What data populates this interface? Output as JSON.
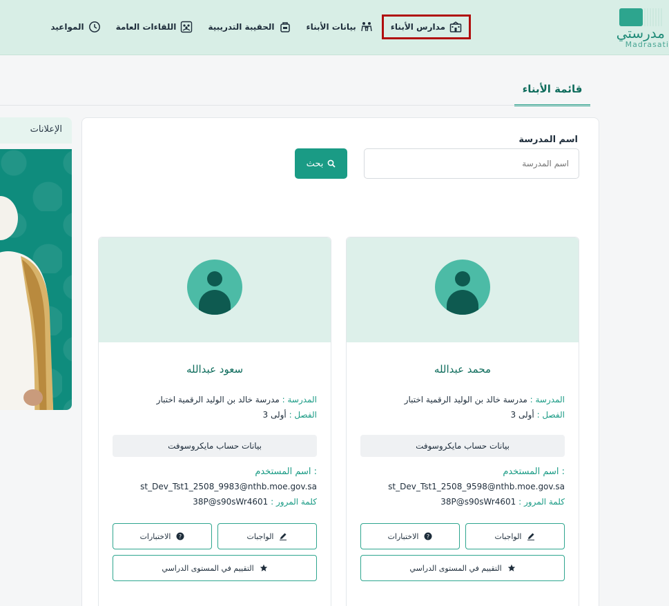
{
  "app": {
    "logo_ar": "مدرستي",
    "logo_en": "Madrasati"
  },
  "nav": {
    "items": [
      {
        "label": "مدارس الأبناء",
        "icon": "school-icon",
        "active": true
      },
      {
        "label": "بيانات الأبناء",
        "icon": "family-icon"
      },
      {
        "label": "الحقيبة التدريبية",
        "icon": "bag-icon"
      },
      {
        "label": "اللقاءات العامة",
        "icon": "meetings-icon"
      },
      {
        "label": "المواعيد",
        "icon": "clock-icon"
      }
    ]
  },
  "page": {
    "tab_label": "قائمة الأبناء",
    "ads_label": "الإعلانات"
  },
  "search": {
    "label": "اسم المدرسة",
    "placeholder": "اسم المدرسة",
    "button_label": "بحث"
  },
  "students": [
    {
      "name": "محمد عبدالله",
      "school_key": "المدرسة :",
      "school": "مدرسة خالد بن الوليد الرقمية اختبار",
      "class_key": "الفصل :",
      "class": "أولى 3",
      "ms_label": "بيانات حساب مايكروسوفت",
      "user_key": "اسم المستخدم :",
      "username": "st_Dev_Tst1_2508_9598@nthb.moe.gov.sa",
      "pass_key": "كلمة المرور :",
      "password": "38P@s90sWr4601",
      "btn_homework": "الواجبات",
      "btn_exams": "الاختبارات",
      "btn_eval": "التقييم في المستوى الدراسي"
    },
    {
      "name": "سعود عبدالله",
      "school_key": "المدرسة :",
      "school": "مدرسة خالد بن الوليد الرقمية اختبار",
      "class_key": "الفصل :",
      "class": "أولى 3",
      "ms_label": "بيانات حساب مايكروسوفت",
      "user_key": "اسم المستخدم :",
      "username": "st_Dev_Tst1_2508_9983@nthb.moe.gov.sa",
      "pass_key": "كلمة المرور :",
      "password": "38P@s90sWr4601",
      "btn_homework": "الواجبات",
      "btn_exams": "الاختبارات",
      "btn_eval": "التقييم في المستوى الدراسي"
    }
  ],
  "colors": {
    "brand": "#1a9b85",
    "topbar": "#d8eee6",
    "highlight": "#b00d0d"
  }
}
